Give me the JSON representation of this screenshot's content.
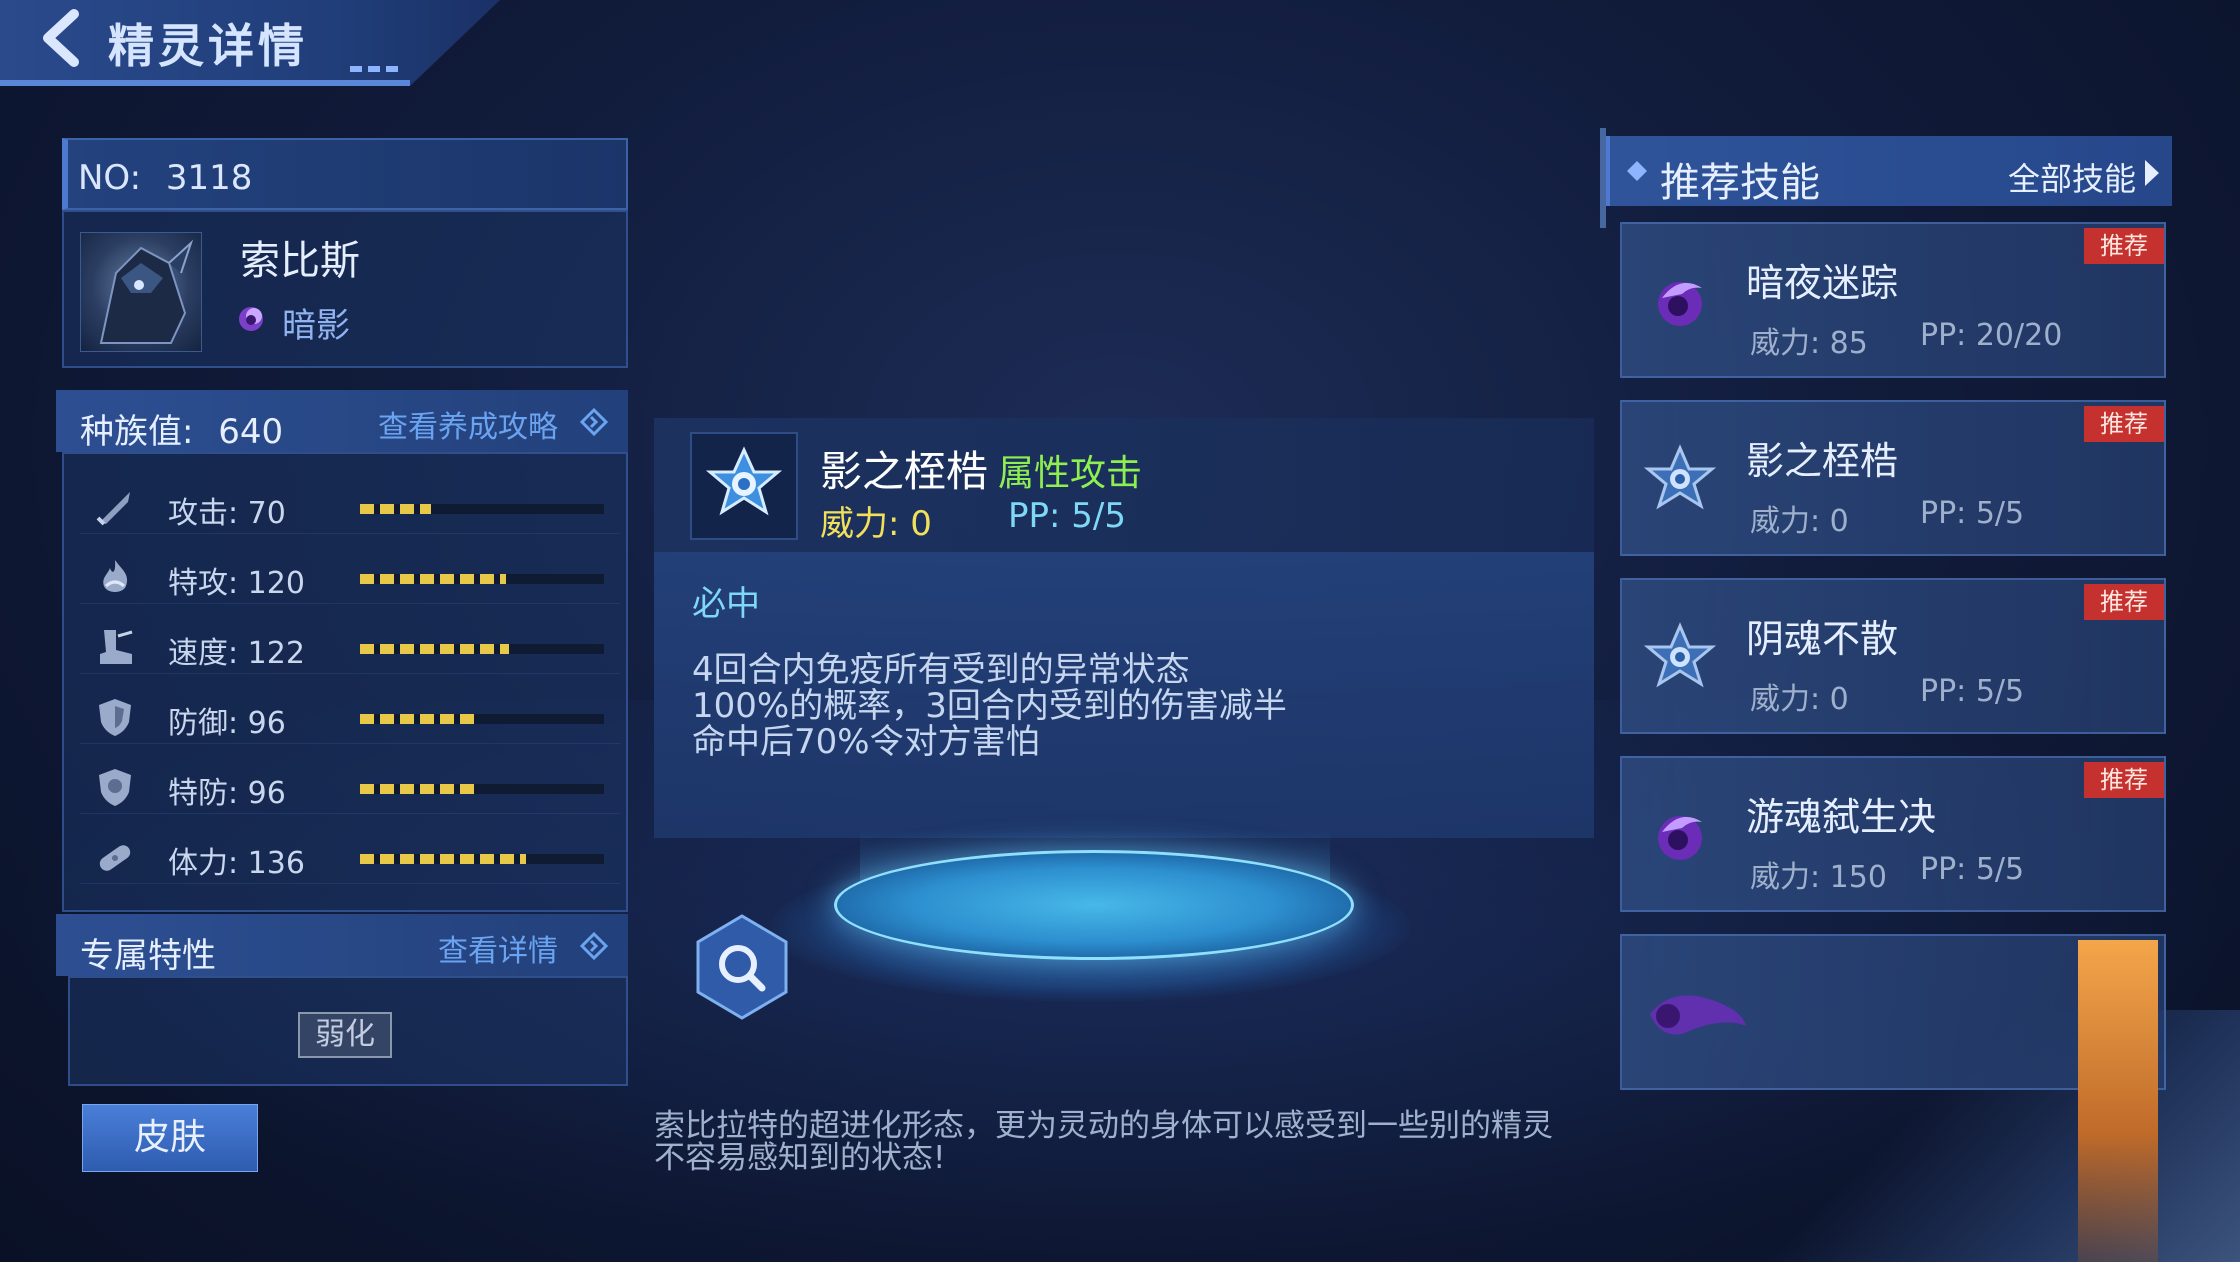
{
  "header": {
    "title": "精灵详情"
  },
  "pet": {
    "no_label": "NO:",
    "no_value": "3118",
    "name": "索比斯",
    "type": "暗影"
  },
  "race": {
    "label": "种族值:",
    "value": "640",
    "link": "查看养成攻略"
  },
  "stats": [
    {
      "label": "攻击:",
      "value": "70",
      "fraction": 0.29,
      "icon": "sword-icon"
    },
    {
      "label": "特攻:",
      "value": "120",
      "fraction": 0.6,
      "icon": "fire-icon"
    },
    {
      "label": "速度:",
      "value": "122",
      "fraction": 0.61,
      "icon": "boot-icon"
    },
    {
      "label": "防御:",
      "value": "96",
      "fraction": 0.47,
      "icon": "shield-icon"
    },
    {
      "label": "特防:",
      "value": "96",
      "fraction": 0.47,
      "icon": "shield-special-icon"
    },
    {
      "label": "体力:",
      "value": "136",
      "fraction": 0.68,
      "icon": "bandage-icon"
    }
  ],
  "trait": {
    "label": "专属特性",
    "link": "查看详情",
    "tag": "弱化"
  },
  "skin_button": "皮肤",
  "detail": {
    "name": "影之桎梏",
    "category": "属性攻击",
    "power": "威力:  0",
    "pp": "PP:  5/5",
    "tag": "必中",
    "lines": [
      "4回合内免疫所有受到的异常状态",
      "100%的概率，3回合内受到的伤害减半",
      "命中后70%令对方害怕"
    ]
  },
  "description": {
    "line1": "索比拉特的超进化形态，更为灵动的身体可以感受到一些别的精灵",
    "line2": "不容易感知到的状态!"
  },
  "recommend": {
    "title": "推荐技能",
    "all": "全部技能",
    "badge": "推荐",
    "skills": [
      {
        "name": "暗夜迷踪",
        "power": "威力:  85",
        "pp": "PP:   20/20",
        "icon": "shadow-orb-icon"
      },
      {
        "name": "影之桎梏",
        "power": "威力:  0",
        "pp": "PP:   5/5",
        "icon": "star-emblem-icon"
      },
      {
        "name": "阴魂不散",
        "power": "威力:  0",
        "pp": "PP:   5/5",
        "icon": "star-emblem-icon"
      },
      {
        "name": "游魂弑生决",
        "power": "威力:  150",
        "pp": "PP:   5/5",
        "icon": "shadow-orb-icon"
      }
    ]
  },
  "colors": {
    "accent": "#4d7ad0",
    "badge": "#c4312e",
    "category": "#8ef050",
    "power": "#f2e05a",
    "pp": "#7fd8f5"
  }
}
